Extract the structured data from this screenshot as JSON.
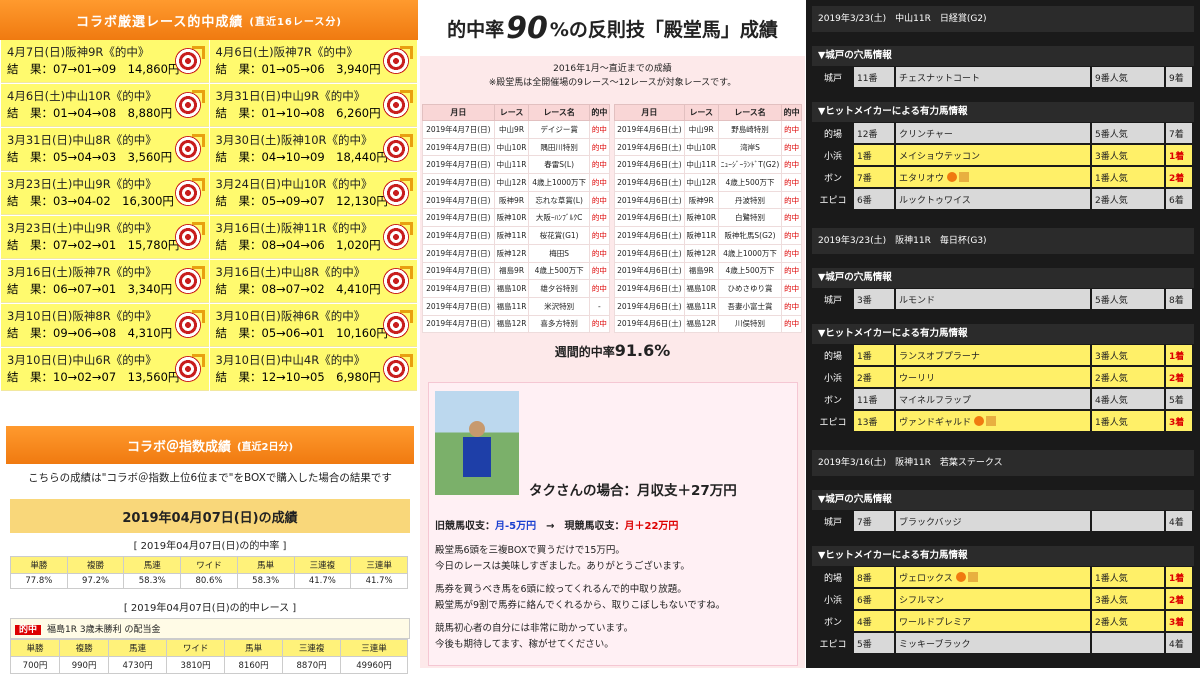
{
  "left": {
    "title": "コラボ厳選レース的中成績",
    "title_note": "(直近16レース分)",
    "cells": [
      {
        "t": "4月7日(日)阪神9R《的中》",
        "r": "結　果：07→01→09　14,860円"
      },
      {
        "t": "4月6日(土)阪神7R《的中》",
        "r": "結　果：01→05→06　3,940円"
      },
      {
        "t": "4月6日(土)中山10R《的中》",
        "r": "結　果：01→04→08　8,880円"
      },
      {
        "t": "3月31日(日)中山9R《的中》",
        "r": "結　果：01→10→08　6,260円"
      },
      {
        "t": "3月31日(日)中山8R《的中》",
        "r": "結　果：05→04→03　3,560円"
      },
      {
        "t": "3月30日(土)阪神10R《的中》",
        "r": "結　果：04→10→09　18,440円"
      },
      {
        "t": "3月23日(土)中山9R《的中》",
        "r": "結　果：03→04-02　16,300円"
      },
      {
        "t": "3月24日(日)中山10R《的中》",
        "r": "結　果：05→09→07　12,130円"
      },
      {
        "t": "3月23日(土)中山9R《的中》",
        "r": "結　果：07→02→01　15,780円"
      },
      {
        "t": "3月16日(土)阪神11R《的中》",
        "r": "結　果：08→04→06　1,020円"
      },
      {
        "t": "3月16日(土)阪神7R《的中》",
        "r": "結　果：06→07→01　3,340円"
      },
      {
        "t": "3月16日(土)中山8R《的中》",
        "r": "結　果：08→07→02　4,410円"
      },
      {
        "t": "3月10日(日)阪神8R《的中》",
        "r": "結　果：09→06→08　4,310円"
      },
      {
        "t": "3月10日(日)阪神6R《的中》",
        "r": "結　果：05→06→01　10,160円"
      },
      {
        "t": "3月10日(日)中山6R《的中》",
        "r": "結　果：10→02→07　13,560円"
      },
      {
        "t": "3月10日(日)中山4R《的中》",
        "r": "結　果：12→10→05　6,980円"
      }
    ]
  },
  "lb": {
    "title": "コラボ＠指数成績",
    "title_note": "(直近2日分)",
    "note": "こちらの成績は\"コラボ＠指数上位6位まで\"をBOXで購入した場合の結果です",
    "day": "2019年04月07日(日)の成績",
    "rate_title": "[ 2019年04月07日(日)の的中率 ]",
    "heads": [
      "単勝",
      "複勝",
      "馬連",
      "ワイド",
      "馬単",
      "三連複",
      "三連単"
    ],
    "rates": [
      "77.8%",
      "97.2%",
      "58.3%",
      "80.6%",
      "58.3%",
      "41.7%",
      "41.7%"
    ],
    "race_title": "[ 2019年04月07日(日)の的中レース ]",
    "race_badge": "的中",
    "race_name": "福島1R 3歳未勝利 の配当金",
    "pays": [
      "700円",
      "990円",
      "4730円",
      "3810円",
      "8160円",
      "8870円",
      "49960円"
    ]
  },
  "mid": {
    "title_a": "的中率",
    "title_big": "90",
    "title_b": "%の反則技「殿堂馬」成績",
    "sub1": "2016年1月～直近までの成績",
    "sub2": "※殿堂馬は全開催場の9レース～12レースが対象レースです。",
    "heads": [
      "月日",
      "レース",
      "レース名",
      "的中"
    ],
    "t1": [
      [
        "2019年4月7日(日)",
        "中山9R",
        "デイジー賞",
        "的中"
      ],
      [
        "2019年4月7日(日)",
        "中山10R",
        "隅田川特別",
        "的中"
      ],
      [
        "2019年4月7日(日)",
        "中山11R",
        "春雷S(L)",
        "的中"
      ],
      [
        "2019年4月7日(日)",
        "中山12R",
        "4歳上1000万下",
        "的中"
      ],
      [
        "2019年4月7日(日)",
        "阪神9R",
        "忘れな草賞(L)",
        "的中"
      ],
      [
        "2019年4月7日(日)",
        "阪神10R",
        "大阪ｰﾊﾝﾌﾞﾙｸC",
        "的中"
      ],
      [
        "2019年4月7日(日)",
        "阪神11R",
        "桜花賞(G1)",
        "的中"
      ],
      [
        "2019年4月7日(日)",
        "阪神12R",
        "梅田S",
        "的中"
      ],
      [
        "2019年4月7日(日)",
        "福島9R",
        "4歳上500万下",
        "的中"
      ],
      [
        "2019年4月7日(日)",
        "福島10R",
        "雄夕谷特別",
        "的中"
      ],
      [
        "2019年4月7日(日)",
        "福島11R",
        "米沢特別",
        "-"
      ],
      [
        "2019年4月7日(日)",
        "福島12R",
        "喜多方特別",
        "的中"
      ]
    ],
    "t2": [
      [
        "2019年4月6日(土)",
        "中山9R",
        "野島崎特別",
        "的中"
      ],
      [
        "2019年4月6日(土)",
        "中山10R",
        "湾岸S",
        "的中"
      ],
      [
        "2019年4月6日(土)",
        "中山11R",
        "ﾆｭｰｼﾞｰﾗﾝﾄﾞT(G2)",
        "的中"
      ],
      [
        "2019年4月6日(土)",
        "中山12R",
        "4歳上500万下",
        "的中"
      ],
      [
        "2019年4月6日(土)",
        "阪神9R",
        "丹波特別",
        "的中"
      ],
      [
        "2019年4月6日(土)",
        "阪神10R",
        "白鷺特別",
        "的中"
      ],
      [
        "2019年4月6日(土)",
        "阪神11R",
        "阪神牝馬S(G2)",
        "的中"
      ],
      [
        "2019年4月6日(土)",
        "阪神12R",
        "4歳上1000万下",
        "的中"
      ],
      [
        "2019年4月6日(土)",
        "福島9R",
        "4歳上500万下",
        "的中"
      ],
      [
        "2019年4月6日(土)",
        "福島10R",
        "ひめさゆり賞",
        "的中"
      ],
      [
        "2019年4月6日(土)",
        "福島11R",
        "吾妻小富士賞",
        "的中"
      ],
      [
        "2019年4月6日(土)",
        "福島12R",
        "川俣特別",
        "的中"
      ]
    ],
    "weekly_a": "週間的中率",
    "weekly_b": "91.6%",
    "taku_head": "タクさんの場合：月収支＋27万円",
    "taku_s1": "旧競馬収支：",
    "taku_s1v": "月-5万円",
    "taku_arrow": "→",
    "taku_s2": "現競馬収支：",
    "taku_s2v": "月＋22万円",
    "lines": [
      "殿堂馬6頭を三複BOXで買うだけで15万円。",
      "今日のレースは美味しすぎました。ありがとうございます。",
      "",
      "馬券を買うべき馬を6頭に絞ってくれるんで的中取り放題。",
      "殿堂馬が9割で馬券に絡んでくれるから、取りこぼしもないですね。",
      "",
      "競馬初心者の自分には非常に助かっています。",
      "今後も期待してます、稼がせてください。"
    ]
  },
  "right": [
    {
      "head": "2019年3/23(土)　中山11R　日経賞(G2)",
      "a": "▼城戸の穴馬情報",
      "arows": [
        {
          "l": "城戸",
          "n": "11番",
          "h": "チェスナットコート",
          "p": "9番人気",
          "r": "9着"
        }
      ],
      "b": "▼ヒットメイカーによる有力馬情報",
      "brows": [
        {
          "l": "的場",
          "n": "12番",
          "h": "クリンチャー",
          "p": "5番人気",
          "r": "7着",
          "y": false
        },
        {
          "l": "小浜",
          "n": "1番",
          "h": "メイショウテッコン",
          "p": "3番人気",
          "r": "1着",
          "y": true
        },
        {
          "l": "ボン",
          "n": "7番",
          "h": "エタリオウ",
          "p": "1番人気",
          "r": "2着",
          "y": true,
          "m": true
        },
        {
          "l": "エピコ",
          "n": "6番",
          "h": "ルックトゥワイス",
          "p": "2番人気",
          "r": "6着",
          "y": false
        }
      ]
    },
    {
      "head": "2019年3/23(土)　阪神11R　毎日杯(G3)",
      "a": "▼城戸の穴馬情報",
      "arows": [
        {
          "l": "城戸",
          "n": "3番",
          "h": "ルモンド",
          "p": "5番人気",
          "r": "8着"
        }
      ],
      "b": "▼ヒットメイカーによる有力馬情報",
      "brows": [
        {
          "l": "的場",
          "n": "1番",
          "h": "ランスオブプラーナ",
          "p": "3番人気",
          "r": "1着",
          "y": true
        },
        {
          "l": "小浜",
          "n": "2番",
          "h": "ウーリリ",
          "p": "2番人気",
          "r": "2着",
          "y": true
        },
        {
          "l": "ボン",
          "n": "11番",
          "h": "マイネルフラップ",
          "p": "4番人気",
          "r": "5着",
          "y": false
        },
        {
          "l": "エピコ",
          "n": "13番",
          "h": "ヴァンドギャルド",
          "p": "1番人気",
          "r": "3着",
          "y": true,
          "m": true
        }
      ]
    },
    {
      "head": "2019年3/16(土)　阪神11R　若葉ステークス",
      "a": "▼城戸の穴馬情報",
      "arows": [
        {
          "l": "城戸",
          "n": "7番",
          "h": "ブラックバッジ",
          "p": "",
          "r": "4着"
        }
      ],
      "b": "▼ヒットメイカーによる有力馬情報",
      "brows": [
        {
          "l": "的場",
          "n": "8番",
          "h": "ヴェロックス",
          "p": "1番人気",
          "r": "1着",
          "y": true,
          "m": true
        },
        {
          "l": "小浜",
          "n": "6番",
          "h": "シフルマン",
          "p": "3番人気",
          "r": "2着",
          "y": true
        },
        {
          "l": "ボン",
          "n": "4番",
          "h": "ワールドプレミア",
          "p": "2番人気",
          "r": "3着",
          "y": true
        },
        {
          "l": "エピコ",
          "n": "5番",
          "h": "ミッキーブラック",
          "p": "",
          "r": "4着",
          "y": false
        }
      ]
    }
  ]
}
